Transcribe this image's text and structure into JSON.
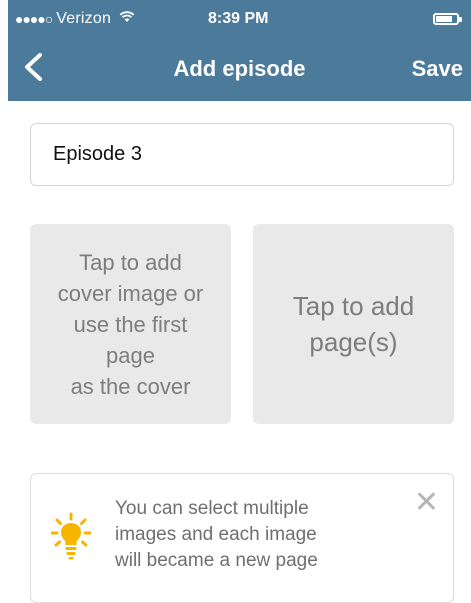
{
  "status_bar": {
    "signal": "●●●●○",
    "carrier": "Verizon",
    "wifi_icon": "wifi-icon",
    "time": "8:39 PM",
    "battery_icon": "battery-icon"
  },
  "nav": {
    "back_icon": "chevron-left-icon",
    "back_glyph": "‹",
    "title": "Add episode",
    "save_label": "Save"
  },
  "episode": {
    "value": "Episode 3"
  },
  "tiles": {
    "cover_lines": [
      "Tap to add",
      "cover image or",
      "use the first",
      "page",
      "as the cover"
    ],
    "pages_lines": [
      "Tap to add",
      "page(s)"
    ]
  },
  "tip": {
    "icon": "lightbulb-icon",
    "lines": [
      "You can select multiple",
      "images and each image",
      "will became a new page"
    ],
    "close_icon": "close-icon",
    "close_glyph": "✕"
  },
  "colors": {
    "header": "#4b7a9b",
    "tile_bg": "#e9e9e9",
    "tile_text": "#7d7d7d",
    "bulb": "#f7b500"
  }
}
